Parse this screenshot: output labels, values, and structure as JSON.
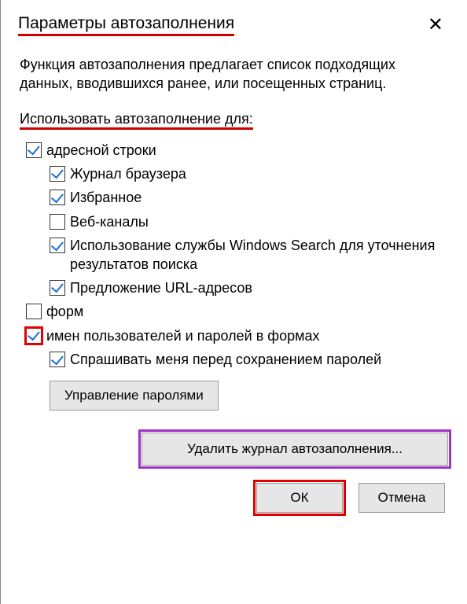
{
  "title": "Параметры автозаполнения",
  "description": "Функция автозаполнения предлагает список подходящих данных, вводившихся ранее, или посещенных страниц.",
  "section_label": "Использовать автозаполнение для:",
  "options": {
    "addr": {
      "label": "адресной строки",
      "checked": true
    },
    "hist": {
      "label": "Журнал браузера",
      "checked": true
    },
    "fav": {
      "label": "Избранное",
      "checked": true
    },
    "feeds": {
      "label": "Веб-каналы",
      "checked": false
    },
    "wsearch": {
      "label": "Использование службы Windows Search для уточнения результатов поиска",
      "checked": true
    },
    "urlsug": {
      "label": "Предложение URL-адресов",
      "checked": true
    },
    "forms": {
      "label": "форм",
      "checked": false
    },
    "creds": {
      "label": "имен пользователей и паролей в формах",
      "checked": true
    },
    "askpwd": {
      "label": "Спрашивать меня перед сохранением паролей",
      "checked": true
    }
  },
  "buttons": {
    "manage_passwords": "Управление паролями",
    "delete_history": "Удалить журнал автозаполнения...",
    "ok": "ОК",
    "cancel": "Отмена"
  }
}
